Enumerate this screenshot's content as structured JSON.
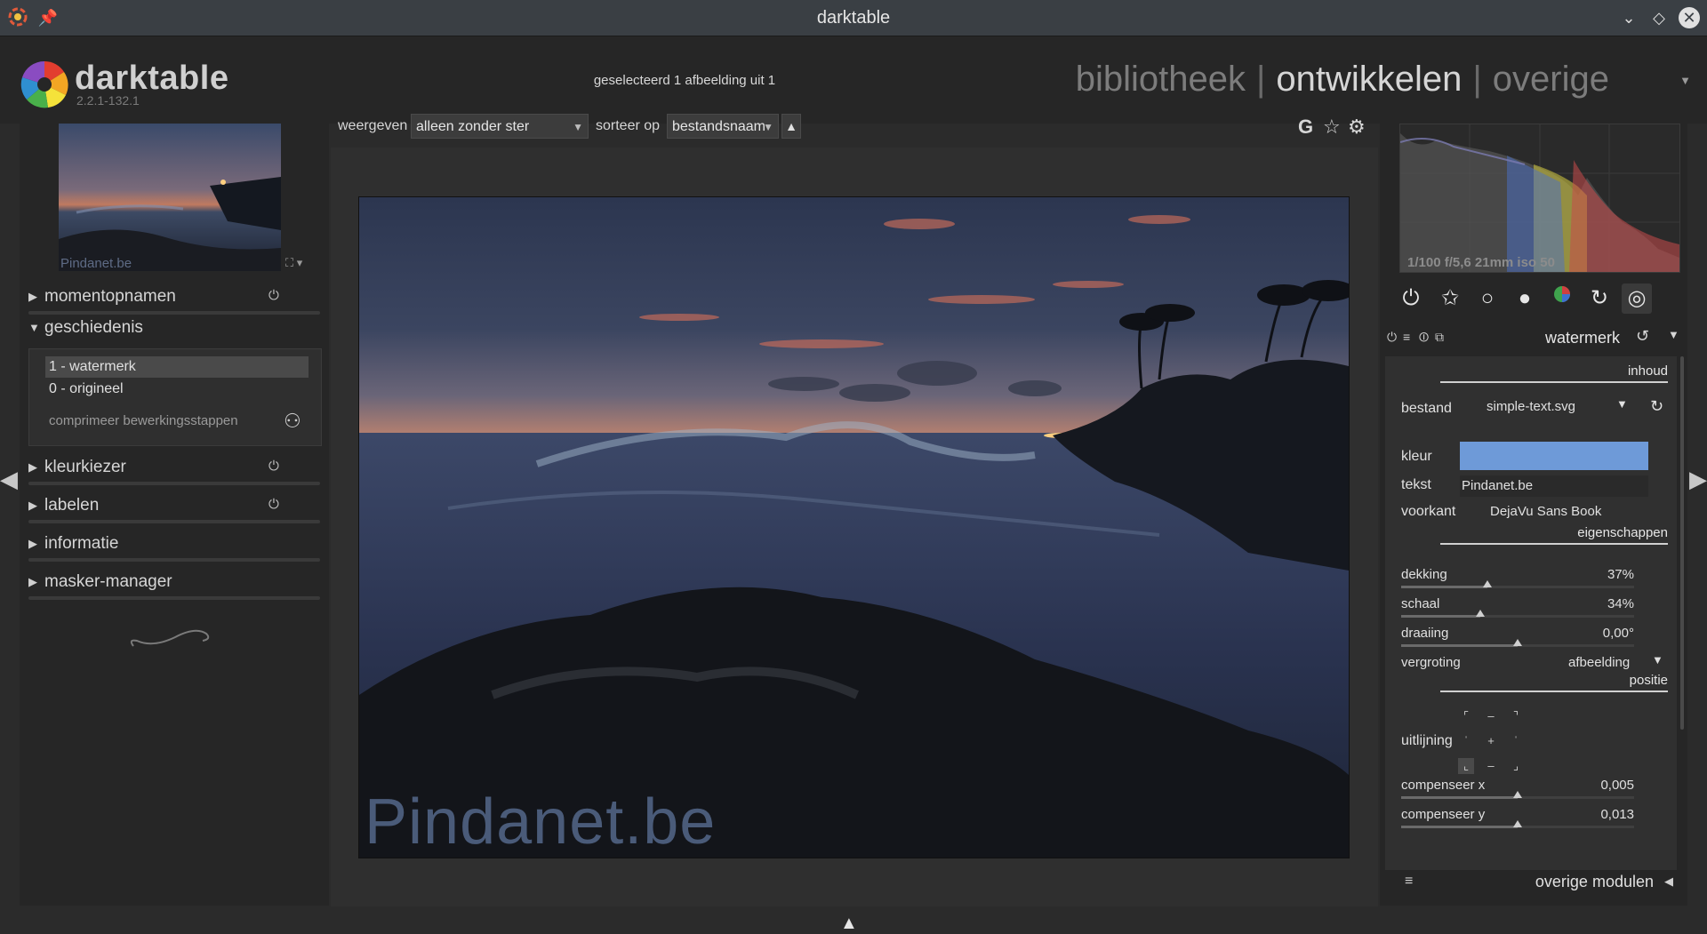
{
  "window": {
    "title": "darktable"
  },
  "header": {
    "app_name": "darktable",
    "version": "2.2.1-132.1",
    "selection_info": "geselecteerd 1 afbeelding uit 1",
    "views": {
      "library": "bibliotheek",
      "darkroom": "ontwikkelen",
      "other": "overige",
      "separator": "|"
    }
  },
  "left": {
    "thumbnail_watermark": "Pindanet.be",
    "sections": [
      {
        "label": "momentopnamen",
        "expanded": false,
        "has_options": true
      },
      {
        "label": "geschiedenis",
        "expanded": true,
        "has_options": false
      },
      {
        "label": "kleurkiezer",
        "expanded": false,
        "has_options": true
      },
      {
        "label": "labelen",
        "expanded": false,
        "has_options": true
      },
      {
        "label": "informatie",
        "expanded": false,
        "has_options": false
      },
      {
        "label": "masker-manager",
        "expanded": false,
        "has_options": false
      }
    ],
    "history": {
      "items": [
        "1 - watermerk",
        "0 - origineel"
      ],
      "selected_index": 0,
      "compress_label": "comprimeer bewerkingsstappen"
    }
  },
  "toolbar": {
    "view_label": "weergeven",
    "view_value": "alleen zonder ster",
    "sort_label": "sorteer op",
    "sort_value": "bestandsnaam",
    "sort_direction": "▲",
    "grouping_label": "G"
  },
  "image": {
    "watermark_text": "Pindanet.be"
  },
  "right": {
    "exif": "1/100 f/5,6 21mm iso 50",
    "module": {
      "name": "watermerk",
      "sections": {
        "content": "inhoud",
        "properties": "eigenschappen",
        "position": "positie"
      },
      "file_label": "bestand",
      "file_value": "simple-text.svg",
      "color_label": "kleur",
      "color_value": "#6e9ad8",
      "text_label": "tekst",
      "text_value": "Pindanet.be",
      "font_label": "voorkant",
      "font_value": "DejaVu Sans Book",
      "opacity": {
        "label": "dekking",
        "value": "37%",
        "level": 0.37
      },
      "scale": {
        "label": "schaal",
        "value": "34%",
        "level": 0.34
      },
      "rotation": {
        "label": "draaiing",
        "value": "0,00°",
        "level": 0.5
      },
      "scale_on_label": "vergroting",
      "scale_on_value": "afbeelding",
      "alignment_label": "uitlijning",
      "alignment_selected": "bottom-left",
      "offset_x": {
        "label": "compenseer x",
        "value": "0,005",
        "level": 0.5
      },
      "offset_y": {
        "label": "compenseer y",
        "value": "0,013",
        "level": 0.5
      }
    },
    "more_modules_label": "overige modulen"
  },
  "colors": {
    "accent_blue": "#6e9ad8",
    "panel_bg": "#262626",
    "center_bg": "#2f2f2f"
  }
}
